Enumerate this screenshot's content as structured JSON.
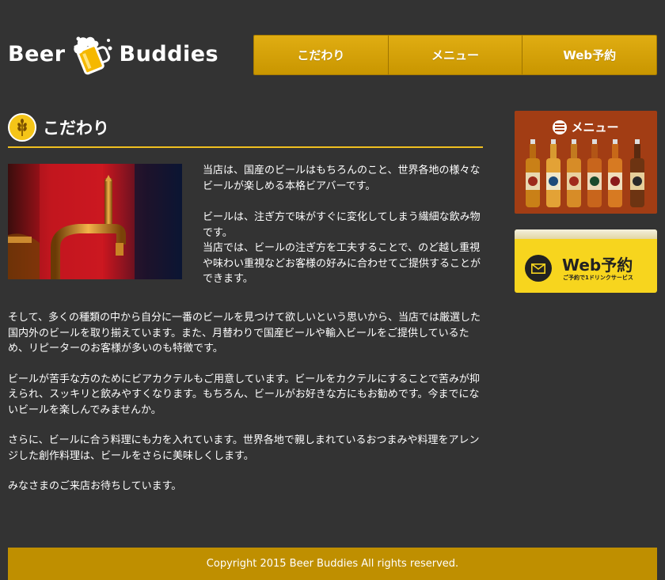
{
  "header": {
    "logo_word_left": "Beer",
    "logo_word_right": "Buddies",
    "nav": [
      {
        "label": "こだわり"
      },
      {
        "label": "メニュー"
      },
      {
        "label": "Web予約"
      }
    ]
  },
  "main": {
    "heading": "こだわり",
    "intro_paragraphs": [
      "当店は、国産のビールはもちろんのこと、世界各地の様々なビールが楽しめる本格ビアバーです。",
      "ビールは、注ぎ方で味がすぐに変化してしまう繊細な飲み物です。\n当店では、ビールの注ぎ方を工夫することで、のど越し重視や味わい重視などお客様の好みに合わせてご提供することができます。"
    ],
    "body_paragraphs": [
      "そして、多くの種類の中から自分に一番のビールを見つけて欲しいという思いから、当店では厳選した国内外のビールを取り揃えています。また、月替わりで国産ビールや輸入ビールをご提供しているため、リピーターのお客様が多いのも特徴です。",
      "ビールが苦手な方のためにビアカクテルもご用意しています。ビールをカクテルにすることで苦みが抑えられ、スッキリと飲みやすくなります。もちろん、ビールがお好きな方にもお勧めです。今までにないビールを楽しんでみませんか。",
      "さらに、ビールに合う料理にも力を入れています。世界各地で親しまれているおつまみや料理をアレンジした創作料理は、ビールをさらに美味しくします。",
      "みなさまのご来店お待ちしています。"
    ]
  },
  "sidebar": {
    "menu_banner_label": "メニュー",
    "web_banner_title": "Web予約",
    "web_banner_sub": "ご予約で1ドリンクサービス"
  },
  "footer": {
    "copyright": "Copyright 2015 Beer Buddies All rights reserved."
  },
  "colors": {
    "background": "#333333",
    "accent": "#c99600",
    "heading_rule": "#f0c020",
    "menu_banner": "#a23d14",
    "web_banner": "#f7d51e"
  }
}
